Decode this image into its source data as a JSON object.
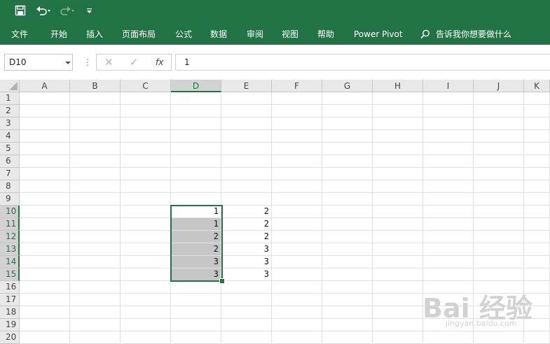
{
  "quick_access": {
    "save_icon": "save-icon",
    "undo_icon": "undo-icon",
    "redo_icon": "redo-icon",
    "customize_icon": "customize-qat-icon"
  },
  "ribbon": {
    "tabs": [
      "文件",
      "开始",
      "插入",
      "页面布局",
      "公式",
      "数据",
      "审阅",
      "视图",
      "帮助",
      "Power Pivot"
    ],
    "tell_me": "告诉我你想要做什么"
  },
  "formula_bar": {
    "name_box": "D10",
    "dots": "⋮",
    "cancel_glyph": "✕",
    "enter_glyph": "✓",
    "fx_label": "fx",
    "value": "1"
  },
  "grid": {
    "columns": [
      "A",
      "B",
      "C",
      "D",
      "E",
      "F",
      "G",
      "H",
      "I",
      "J",
      "K"
    ],
    "rows": [
      "1",
      "2",
      "3",
      "4",
      "5",
      "6",
      "7",
      "8",
      "9",
      "10",
      "11",
      "12",
      "13",
      "14",
      "15",
      "16",
      "17",
      "18",
      "19",
      "20"
    ],
    "selected_column": "D",
    "selected_rows": [
      "10",
      "11",
      "12",
      "13",
      "14",
      "15"
    ],
    "active_cell": "D10",
    "cells": [
      {
        "ref": "D10",
        "value": "1"
      },
      {
        "ref": "D11",
        "value": "1"
      },
      {
        "ref": "D12",
        "value": "2"
      },
      {
        "ref": "D13",
        "value": "2"
      },
      {
        "ref": "D14",
        "value": "3"
      },
      {
        "ref": "D15",
        "value": "3"
      },
      {
        "ref": "E10",
        "value": "2"
      },
      {
        "ref": "E11",
        "value": "2"
      },
      {
        "ref": "E12",
        "value": "2"
      },
      {
        "ref": "E13",
        "value": "3"
      },
      {
        "ref": "E14",
        "value": "3"
      },
      {
        "ref": "E15",
        "value": "3"
      }
    ]
  },
  "watermark": {
    "logo_text": "Bai 经验",
    "url": "jingyan.baidu.com"
  },
  "colors": {
    "excel_green": "#217346",
    "selection_fill": "#c6c6c6",
    "header_fill": "#e9e9e9"
  }
}
